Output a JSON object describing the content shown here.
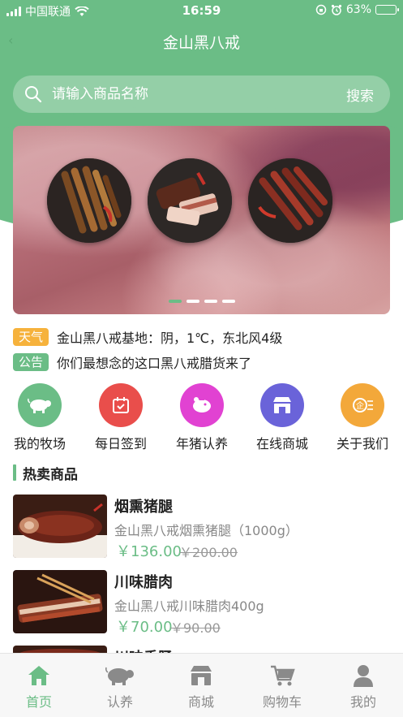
{
  "statusbar": {
    "carrier": "中国联通",
    "time": "16:59",
    "battery": "63%"
  },
  "navbar": {
    "back_icon": "chevron-left-icon",
    "title": "金山黑八戒"
  },
  "search": {
    "placeholder": "请输入商品名称",
    "button": "搜索"
  },
  "banner": {
    "slides": 4,
    "active_slide": 1
  },
  "notices": [
    {
      "tag": "天气",
      "text": "金山黑八戒基地：阴，1℃，东北风4级",
      "color": "#f6b23c"
    },
    {
      "tag": "公告",
      "text": "你们最想念的这口黑八戒腊货来了",
      "color": "#6bbd86"
    }
  ],
  "categories": [
    {
      "label": "我的牧场",
      "icon": "pig-icon",
      "color": "#6bbd86"
    },
    {
      "label": "每日签到",
      "icon": "calendar-check-icon",
      "color": "#e94e4b"
    },
    {
      "label": "年猪认养",
      "icon": "piggy-bank-icon",
      "color": "#e142d2"
    },
    {
      "label": "在线商城",
      "icon": "store-icon",
      "color": "#6a63d9"
    },
    {
      "label": "关于我们",
      "icon": "company-icon",
      "color": "#f3a83a"
    }
  ],
  "section": {
    "title": "热卖商品"
  },
  "products": [
    {
      "name": "烟熏猪腿",
      "desc": "金山黑八戒烟熏猪腿（1000g）",
      "price": "￥136.00",
      "old_price": "￥200.00"
    },
    {
      "name": "川味腊肉",
      "desc": "金山黑八戒川味腊肉400g",
      "price": "￥70.00",
      "old_price": "￥90.00"
    },
    {
      "name": "川味香肠"
    }
  ],
  "tabs": [
    {
      "label": "首页",
      "icon": "home-icon",
      "active": true
    },
    {
      "label": "认养",
      "icon": "pig-icon"
    },
    {
      "label": "商城",
      "icon": "store-icon"
    },
    {
      "label": "购物车",
      "icon": "cart-icon"
    },
    {
      "label": "我的",
      "icon": "user-icon"
    }
  ],
  "colors": {
    "brand": "#6bbd86",
    "price": "#6bbd86",
    "tab_inactive": "#8a8a8a"
  }
}
